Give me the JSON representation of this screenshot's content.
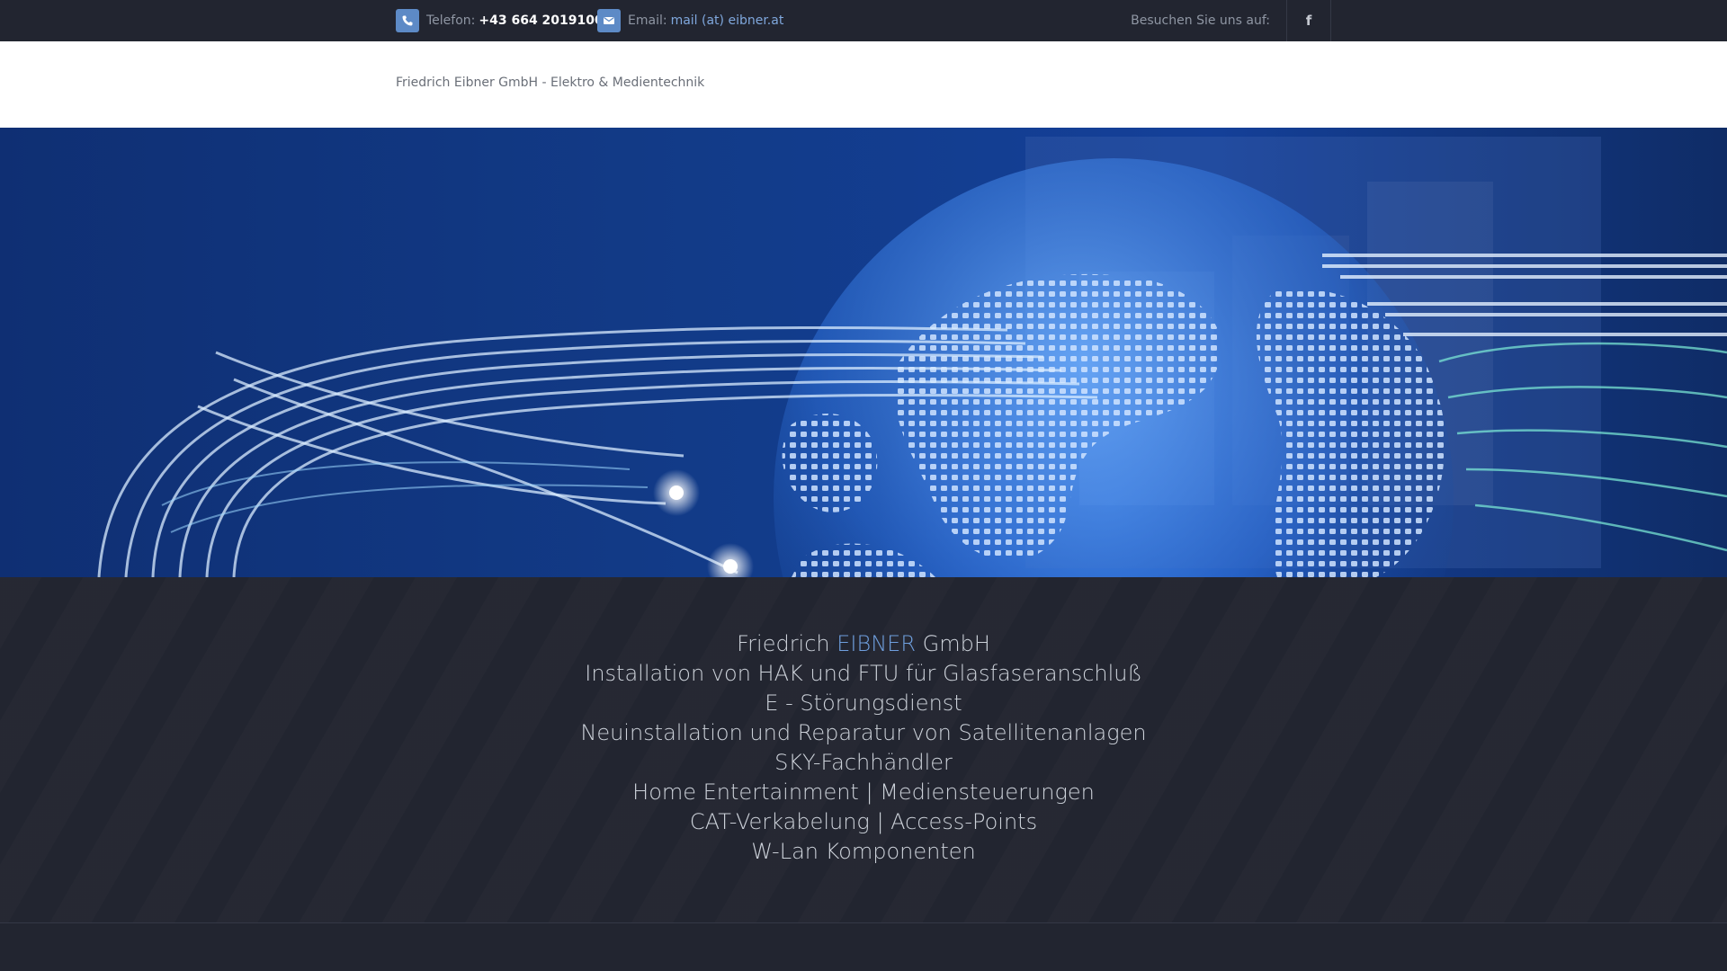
{
  "topbar": {
    "phone_label": "Telefon:",
    "phone_value": "+43 664 2019100",
    "email_label": "Email:",
    "email_value": "mail (at) eibner.at",
    "visit_label": "Besuchen Sie uns auf:",
    "facebook_glyph": "f",
    "icons": {
      "phone": "phone-icon",
      "mail": "mail-icon",
      "social": "facebook-icon"
    }
  },
  "header": {
    "site_title": "Friedrich Eibner GmbH - Elektro & Medientechnik"
  },
  "hero": {
    "image": "fiber-optic-globe-banner"
  },
  "content": {
    "company_prefix": "Friedrich ",
    "company_accent": "EIBNER",
    "company_suffix": " GmbH",
    "services": [
      "Installation von HAK und FTU für Glasfaseranschluß",
      "E - Störungsdienst",
      "Neuinstallation und Reparatur von Satellitenanlagen",
      "SKY-Fachhändler",
      "Home Entertainment | Mediensteuerungen",
      "CAT-Verkabelung | Access-Points",
      "W-Lan Komponenten"
    ]
  },
  "colors": {
    "accent": "#6f9fde",
    "icon_bg": "#5d8ac6",
    "dark_bg": "#232631",
    "topbar_bg": "#222530"
  }
}
